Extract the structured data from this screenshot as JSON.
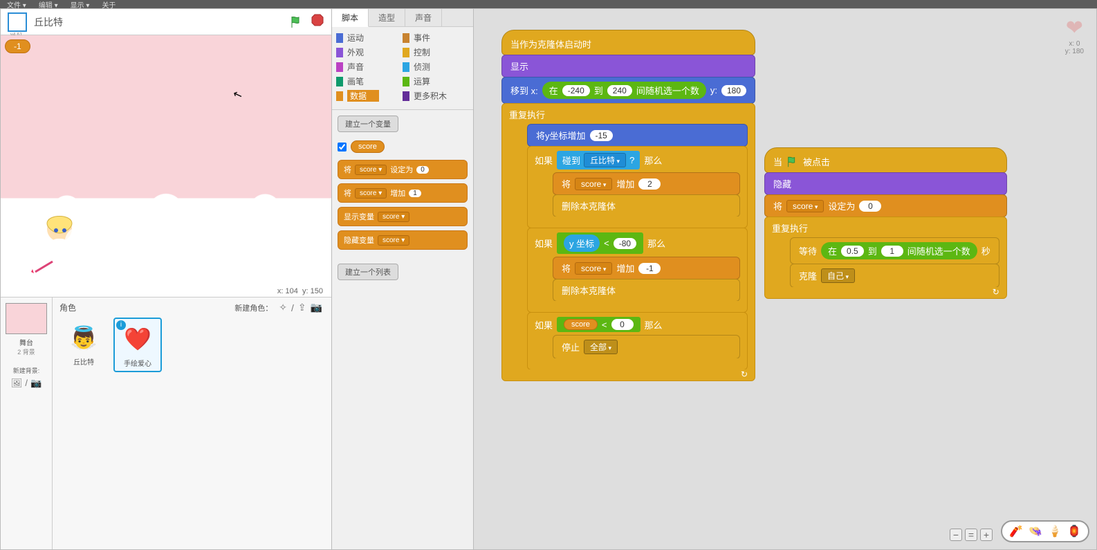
{
  "menubar": {
    "items": [
      "文件 ▾",
      "编辑 ▾",
      "显示 ▾",
      "关于"
    ]
  },
  "stage": {
    "sprite_name": "丘比特",
    "score_display": "-1",
    "mouse_x_label": "x:",
    "mouse_x": "104",
    "mouse_y_label": "y:",
    "mouse_y": "150"
  },
  "sprite_panel": {
    "roles_label": "角色",
    "new_role_label": "新建角色：",
    "backdrop": {
      "label": "舞台",
      "sub": "2 背景",
      "new_bg": "新建背景:"
    },
    "sprites": [
      {
        "name": "丘比特",
        "emoji": "👼"
      },
      {
        "name": "手绘爱心",
        "emoji": "❤️",
        "selected": true
      }
    ]
  },
  "tabs": {
    "scripts": "脚本",
    "costumes": "造型",
    "sounds": "声音"
  },
  "categories": [
    {
      "name": "运动",
      "color": "#4a6cd4"
    },
    {
      "name": "事件",
      "color": "#c88330"
    },
    {
      "name": "外观",
      "color": "#8a55d7"
    },
    {
      "name": "控制",
      "color": "#e0a81f"
    },
    {
      "name": "声音",
      "color": "#bb42c3"
    },
    {
      "name": "侦测",
      "color": "#2ca5e2"
    },
    {
      "name": "画笔",
      "color": "#0e9a6c"
    },
    {
      "name": "运算",
      "color": "#5cb712"
    },
    {
      "name": "数据",
      "color": "#e08f1f",
      "selected": true
    },
    {
      "name": "更多积木",
      "color": "#632d99"
    }
  ],
  "palette": {
    "make_var": "建立一个变量",
    "var_name": "score",
    "set_to_label": "将",
    "set_to_label2": "设定为",
    "set_to_val": "0",
    "change_by_label": "将",
    "change_by_label2": "增加",
    "change_by_val": "1",
    "show_var": "显示变量",
    "hide_var": "隐藏变量",
    "make_list": "建立一个列表"
  },
  "script_info": {
    "x_label": "x: 0",
    "y_label": "y: 180"
  },
  "stack1": {
    "hat": "当作为克隆体启动时",
    "show": "显示",
    "goto_pre": "移到 x:",
    "rand_in": "在",
    "rand_to": "到",
    "rand_pick": "间随机选一个数",
    "rand_lo": "-240",
    "rand_hi": "240",
    "goto_y": "y:",
    "goto_yv": "180",
    "forever": "重复执行",
    "changey": "将y坐标增加",
    "changey_v": "-15",
    "if": "如果",
    "then": "那么",
    "touching": "碰到",
    "touching_target": "丘比特",
    "touching_q": "?",
    "set": "将",
    "var": "score",
    "by": "增加",
    "by_v": "2",
    "delclone": "删除本克隆体",
    "yless": "y 坐标",
    "lt": "<",
    "lt_v": "-80",
    "by_v2": "-1",
    "scorelt_v": "0",
    "stop": "停止",
    "stop_opt": "全部"
  },
  "stack2": {
    "hat_when": "当",
    "hat_clicked": "被点击",
    "hide": "隐藏",
    "set": "将",
    "var": "score",
    "setto": "设定为",
    "setto_v": "0",
    "forever": "重复执行",
    "wait": "等待",
    "rand_in": "在",
    "wait_lo": "0.5",
    "rand_to": "到",
    "wait_hi": "1",
    "rand_pick": "间随机选一个数",
    "secs": "秒",
    "clone": "克隆",
    "clone_t": "自己"
  }
}
